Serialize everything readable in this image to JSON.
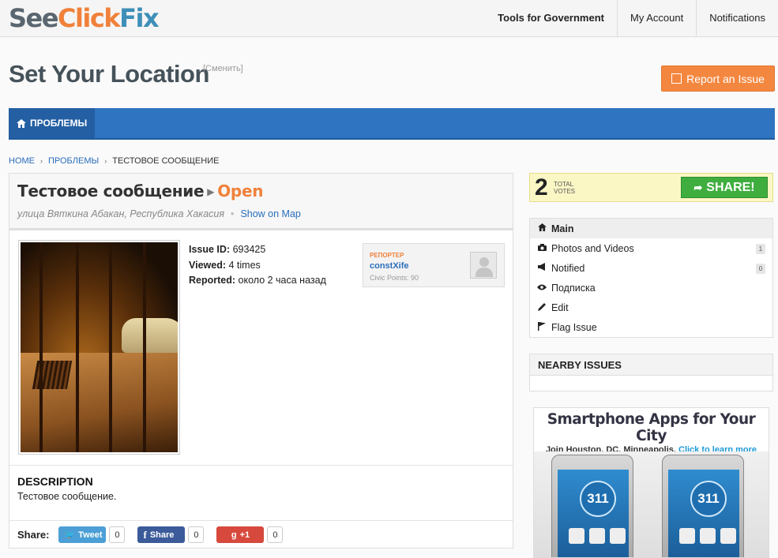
{
  "brand": {
    "see": "See",
    "click": "Click",
    "fix": "Fix"
  },
  "topnav": {
    "tools": "Tools for Government",
    "account": "My Account",
    "notifications": "Notifications"
  },
  "header": {
    "title": "Set Your Location",
    "change": "[Сменить]",
    "report_button": "Report an Issue"
  },
  "bluebar": {
    "tab_label": "ПРОБЛЕМЫ"
  },
  "breadcrumb": {
    "home": "HOME",
    "issues": "ПРОБЛЕМЫ",
    "current": "ТЕСТОВОЕ СООБЩЕНИЕ"
  },
  "issue": {
    "title": "Тестовое сообщение",
    "status": "Open",
    "address": "улица Вяткина Абакан, Республика Хакасия",
    "show_on_map": "Show on Map",
    "id_label": "Issue ID:",
    "id_value": "693425",
    "viewed_label": "Viewed:",
    "viewed_value": "4 times",
    "reported_label": "Reported:",
    "reported_value": "около 2 часа назад"
  },
  "reporter": {
    "role": "РЕПОРТЕР",
    "name": "constXife",
    "points": "Civic Points: 90"
  },
  "description": {
    "heading": "DESCRIPTION",
    "text": "Тестовое сообщение."
  },
  "share": {
    "label": "Share:",
    "tweet": "Tweet",
    "tweet_count": "0",
    "fb": "Share",
    "fb_count": "0",
    "gplus": "+1",
    "gplus_count": "0"
  },
  "votes": {
    "count": "2",
    "label_line1": "TOTAL",
    "label_line2": "VOTES",
    "share_button": "SHARE!"
  },
  "sidenav": {
    "items": [
      {
        "label": "Main",
        "icon": "home-icon"
      },
      {
        "label": "Photos and Videos",
        "icon": "camera-icon",
        "badge": "1"
      },
      {
        "label": "Notified",
        "icon": "megaphone-icon",
        "badge": "0"
      },
      {
        "label": "Подписка",
        "icon": "eye-icon"
      },
      {
        "label": "Edit",
        "icon": "pencil-icon"
      },
      {
        "label": "Flag Issue",
        "icon": "flag-icon"
      }
    ]
  },
  "nearby": {
    "heading": "NEARBY ISSUES"
  },
  "ad": {
    "title": "Smartphone Apps for Your City",
    "sub": "Join Houston, DC, Minneapolis.",
    "learn_more": "Click to learn more",
    "logo_text": "311"
  },
  "colors": {
    "accent_orange": "#f4873f",
    "nav_blue": "#2e74c0",
    "share_green": "#3fae3f",
    "status_orange": "#f0813a"
  }
}
